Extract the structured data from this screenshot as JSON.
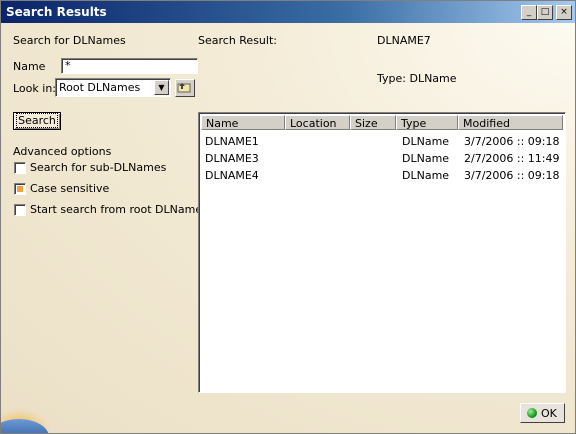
{
  "window": {
    "title": "Search Results"
  },
  "titlebar_buttons": {
    "minimize": "_",
    "maximize": "□",
    "close": "×"
  },
  "form": {
    "search_for": "Search for DLNames",
    "name_label": "Name",
    "name_value": "*",
    "look_in_label": "Look in:",
    "look_in_value": "Root DLNames",
    "search_button": "Search"
  },
  "advanced": {
    "heading": "Advanced options",
    "options": [
      {
        "label": "Search for sub-DLNames",
        "checked": false
      },
      {
        "label": "Case sensitive",
        "checked": true
      },
      {
        "label": "Start search from root DLName",
        "checked": false
      }
    ]
  },
  "result_info": {
    "label": "Search Result:",
    "value": "DLNAME7",
    "type_text": "Type: DLName"
  },
  "results": {
    "columns": [
      "Name",
      "Location",
      "Size",
      "Type",
      "Modified"
    ],
    "rows": [
      [
        "DLNAME1",
        "",
        "",
        "DLName",
        "3/7/2006 :: 09:18"
      ],
      [
        "DLNAME3",
        "",
        "",
        "DLName",
        "2/7/2006 :: 11:49"
      ],
      [
        "DLNAME4",
        "",
        "",
        "DLName",
        "3/7/2006 :: 09:18"
      ]
    ]
  },
  "footer": {
    "ok_button": "OK"
  },
  "icons": {
    "dropdown": "chevron-down-icon",
    "up_folder": "up-folder-icon",
    "ok": "ok-green-icon"
  }
}
